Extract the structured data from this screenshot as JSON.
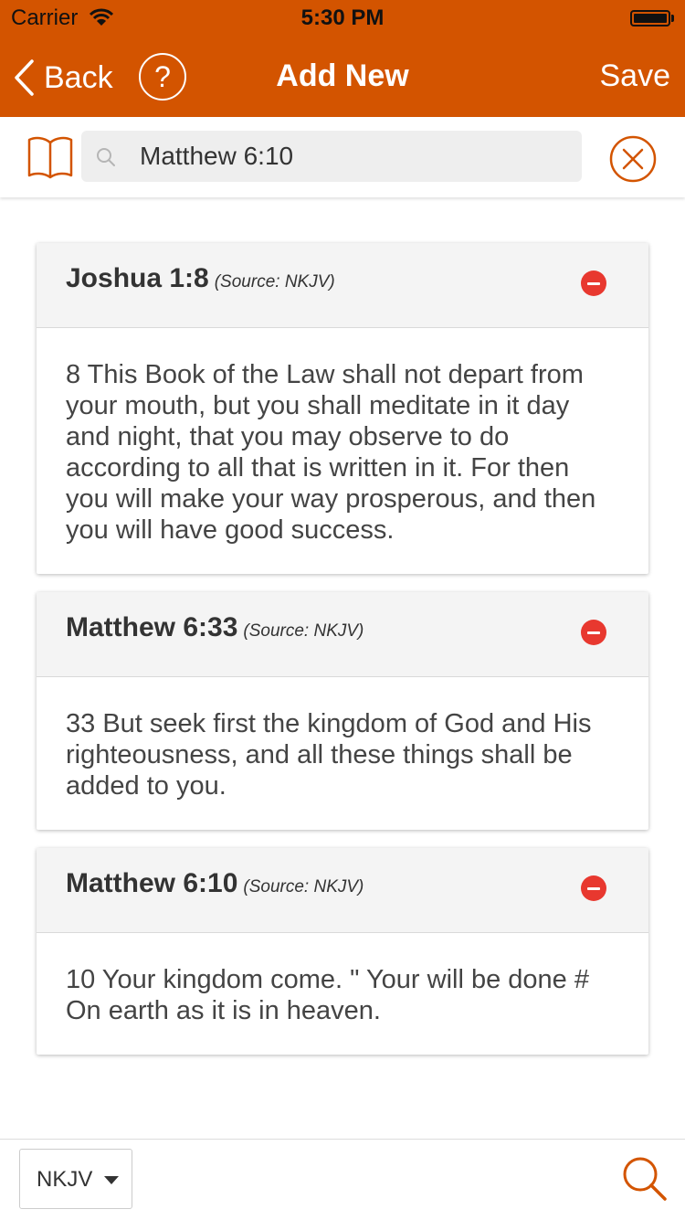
{
  "status_bar": {
    "carrier": "Carrier",
    "time": "5:30 PM"
  },
  "nav": {
    "back_label": "Back",
    "help_label": "?",
    "title": "Add New",
    "save_label": "Save"
  },
  "search": {
    "value": "Matthew 6:10"
  },
  "verses": [
    {
      "reference": "Joshua 1:8",
      "source": "(Source: NKJV)",
      "text": "8 This Book of the Law shall not depart from your mouth, but you shall meditate in it day and night, that you may observe to do according to all that is written in it. For then you will make your way prosperous, and then you will have good success."
    },
    {
      "reference": "Matthew 6:33",
      "source": "(Source: NKJV)",
      "text": "33 But seek first the kingdom of God and His righteousness, and all these things shall be added to you."
    },
    {
      "reference": "Matthew 6:10",
      "source": "(Source: NKJV)",
      "text": "10 Your kingdom come. \" Your will be done # On earth as it is in heaven."
    }
  ],
  "bottom_bar": {
    "version": "NKJV"
  },
  "colors": {
    "accent": "#d35400",
    "remove": "#e8382f"
  }
}
